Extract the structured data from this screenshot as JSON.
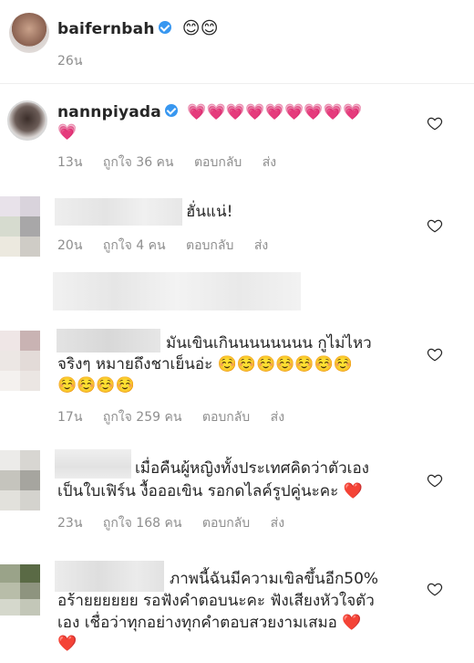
{
  "post": {
    "username": "baifernbah",
    "caption_emoji": "😊😊",
    "time": "26น"
  },
  "comments": [
    {
      "username": "nannpiyada",
      "text_line1": "💗💗💗💗💗💗💗💗💗",
      "text_line2": "💗",
      "time": "13น",
      "likes": "ถูกใจ 36 คน",
      "reply": "ตอบกลับ",
      "send": "ส่ง"
    },
    {
      "text_line1": "ฮั่นแน่!",
      "time": "20น",
      "likes": "ถูกใจ 4 คน",
      "reply": "ตอบกลับ",
      "send": "ส่ง"
    },
    {
      "text_line1": "มันเขินเกินนนนนนนน กูไม่ไหว",
      "text_line2": "จริงๆ หมายถึงชาเย็นอ่ะ ☺️☺️☺️☺️☺️☺️☺️",
      "text_line3": "☺️☺️☺️☺️",
      "time": "17น",
      "likes": "ถูกใจ 259 คน",
      "reply": "ตอบกลับ",
      "send": "ส่ง"
    },
    {
      "text_line1": "เมื่อคืนผู้หญิงทั้งประเทศคิดว่าตัวเอง",
      "text_line2": "เป็นใบเฟิร์น งื้อออเขิน รอกดไลค์รูปคู่นะคะ ❤️",
      "time": "23น",
      "likes": "ถูกใจ 168 คน",
      "reply": "ตอบกลับ",
      "send": "ส่ง"
    },
    {
      "text_line1": "ภาพนี้ฉันมีความเขิลขึ้นอีก50%",
      "text_line2": "อร้ายยยยยย รอฟังคำตอบนะคะ ฟังเสียงหัวใจตัว",
      "text_line3": "เอง เชื่อว่าทุกอย่างทุกคำตอบสวยงามเสมอ ❤️",
      "text_line4": "❤️"
    }
  ],
  "colors": {
    "text": "#262626",
    "meta": "#8e8e8e",
    "verified": "#3897f0",
    "divider": "#efefef"
  },
  "icons": {
    "like": "heart-outline-icon",
    "verified": "verified-badge-icon"
  }
}
